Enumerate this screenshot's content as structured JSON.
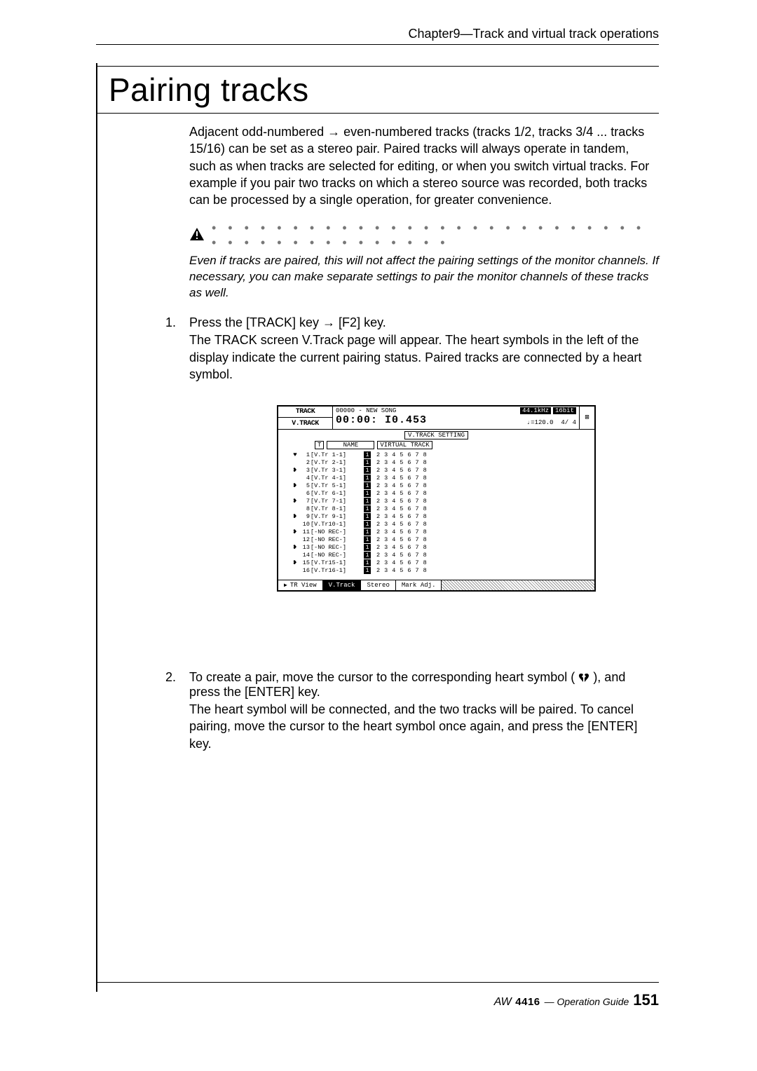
{
  "header": {
    "chapter": "Chapter9—Track and virtual track operations"
  },
  "title": "Pairing tracks",
  "intro": "Adjacent odd-numbered → even-numbered tracks (tracks 1/2, tracks 3/4 ... tracks 15/16) can be set as a stereo pair. Paired tracks will always operate in tandem, such as when tracks are selected for editing, or when you switch virtual tracks. For example if you pair two tracks on which a stereo source was recorded, both tracks can be processed by a single operation, for greater convenience.",
  "callout": "Even if tracks are paired, this will not affect the pairing settings of the monitor channels. If necessary, you can make separate settings to pair the monitor channels of these tracks as well.",
  "step1": {
    "num": "1.",
    "head": "Press the [TRACK] key → [F2] key.",
    "desc": "The TRACK screen V.Track page will appear. The heart symbols in the left of the display indicate the current pairing status. Paired tracks are connected by a heart symbol."
  },
  "step2": {
    "num": "2.",
    "head_a": "To create a pair, move the cursor to the corresponding heart symbol (",
    "head_b": "), and press the [ENTER] key.",
    "desc": "The heart symbol will be connected, and the two tracks will be paired. To cancel pairing, move the cursor to the heart symbol once again, and press the [ENTER] key."
  },
  "lcd": {
    "tabs": [
      "TRACK",
      "V.TRACK"
    ],
    "song_id": "00000 - NEW SONG",
    "badges": [
      "44.1kHz",
      "16bit"
    ],
    "timecode": "00:00: I0.453",
    "tempo": "♩=120.0",
    "meter": "4/ 4",
    "mark_icon": "⊠",
    "section_title": "V.TRACK SETTING",
    "colhead": {
      "t": "T",
      "name": "NAME",
      "vt": "VIRTUAL TRACK"
    },
    "vt_numbers": "2 3 4 5 6 7 8",
    "tracks": [
      {
        "pair_top": "♥",
        "idx": "1",
        "name": "[V.Tr 1-1]",
        "curr": "1"
      },
      {
        "pair_top": "",
        "idx": "2",
        "name": "[V.Tr 2-1]",
        "curr": "1"
      },
      {
        "pair_top": "❥",
        "idx": "3",
        "name": "[V.Tr 3-1]",
        "curr": "1"
      },
      {
        "pair_top": "",
        "idx": "4",
        "name": "[V.Tr 4-1]",
        "curr": "1"
      },
      {
        "pair_top": "❥",
        "idx": "5",
        "name": "[V.Tr 5-1]",
        "curr": "1"
      },
      {
        "pair_top": "",
        "idx": "6",
        "name": "[V.Tr 6-1]",
        "curr": "1"
      },
      {
        "pair_top": "❥",
        "idx": "7",
        "name": "[V.Tr 7-1]",
        "curr": "1"
      },
      {
        "pair_top": "",
        "idx": "8",
        "name": "[V.Tr 8-1]",
        "curr": "1"
      },
      {
        "pair_top": "❥",
        "idx": "9",
        "name": "[V.Tr 9-1]",
        "curr": "1"
      },
      {
        "pair_top": "",
        "idx": "10",
        "name": "[V.Tr10-1]",
        "curr": "1"
      },
      {
        "pair_top": "❥",
        "idx": "11",
        "name": "[-NO REC-]",
        "curr": "1"
      },
      {
        "pair_top": "",
        "idx": "12",
        "name": "[-NO REC-]",
        "curr": "1"
      },
      {
        "pair_top": "❥",
        "idx": "13",
        "name": "[-NO REC-]",
        "curr": "1"
      },
      {
        "pair_top": "",
        "idx": "14",
        "name": "[-NO REC-]",
        "curr": "1"
      },
      {
        "pair_top": "❥",
        "idx": "15",
        "name": "[V.Tr15-1]",
        "curr": "1"
      },
      {
        "pair_top": "",
        "idx": "16",
        "name": "[V.Tr16-1]",
        "curr": "1"
      }
    ],
    "bottom_tabs": [
      {
        "label": "TR View",
        "selected": false,
        "icon": "▶"
      },
      {
        "label": "V.Track",
        "selected": true,
        "icon": ""
      },
      {
        "label": "Stereo",
        "selected": false,
        "icon": ""
      },
      {
        "label": "Mark Adj.",
        "selected": false,
        "icon": ""
      }
    ]
  },
  "footer": {
    "brand": "AW",
    "model": "4416",
    "guide": "— Operation Guide",
    "page": "151"
  }
}
